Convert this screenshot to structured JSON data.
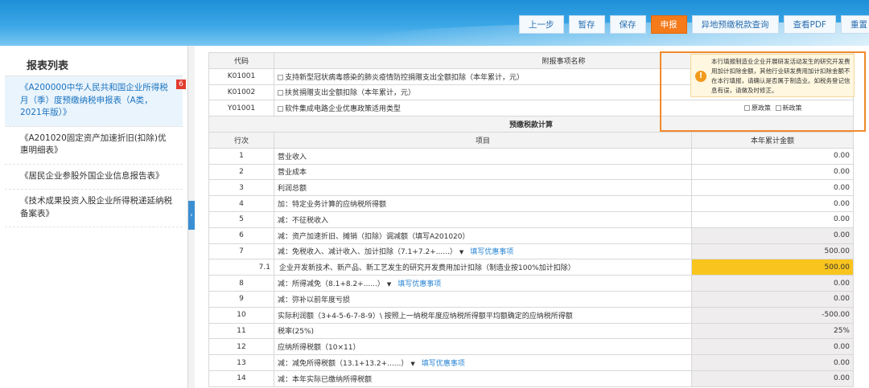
{
  "toolbar": {
    "prev": "上一步",
    "draft": "暂存",
    "save": "保存",
    "declare": "申报",
    "remote": "异地预缴税款查询",
    "pdf": "查看PDF",
    "reset": "重置"
  },
  "sidebar": {
    "title": "报表列表",
    "items": [
      {
        "label": "《A200000中华人民共和国企业所得税月（季）度预缴纳税申报表（A类，2021年版）》",
        "badge": "6"
      },
      {
        "label": "《A201020固定资产加速折旧(扣除)优惠明细表》"
      },
      {
        "label": "《居民企业参股外国企业信息报告表》"
      },
      {
        "label": "《技术成果投资入股企业所得税递延纳税备案表》"
      }
    ]
  },
  "tip": {
    "text": "本行填报制造业企业开展研发活动发生的研究开发费用加计扣除金额，其他行业研发费用加计扣除金额不在本行填报，请确认是否属于制造业。如税务登记信息有误，请做及时修正。",
    "option_old": "原政策",
    "option_new": "新政策"
  },
  "attach": {
    "col_code": "代码",
    "col_name": "附报事项名称",
    "rows": [
      {
        "code": "K01001",
        "name": "支持新型冠状病毒感染的肺炎疫情防控捐赠支出全额扣除（本年累计，元）"
      },
      {
        "code": "K01002",
        "name": "扶贫捐赠支出全额扣除（本年累计，元）"
      },
      {
        "code": "Y01001",
        "name": "软件集成电路企业优惠政策适用类型"
      }
    ]
  },
  "calc": {
    "section_title": "预缴税款计算",
    "col_row": "行次",
    "col_item": "项目",
    "col_amount": "本年累计金额",
    "link_text": "填写优惠事项",
    "rows": [
      {
        "no": "1",
        "item": "营业收入",
        "amount": "0.00"
      },
      {
        "no": "2",
        "item": "营业成本",
        "amount": "0.00"
      },
      {
        "no": "3",
        "item": "利润总额",
        "amount": "0.00"
      },
      {
        "no": "4",
        "item": "加：特定业务计算的应纳税所得额",
        "amount": "0.00"
      },
      {
        "no": "5",
        "item": "减：不征税收入",
        "amount": "0.00"
      },
      {
        "no": "6",
        "item": "减：资产加速折旧、摊销（扣除）调减额（填写A201020）",
        "amount": "0.00"
      },
      {
        "no": "7",
        "item": "减：免税收入、减计收入、加计扣除（7.1+7.2+......）",
        "amount": "500.00"
      },
      {
        "no": "7.1",
        "item": "企业开发新技术、新产品、新工艺发生的研究开发费用加计扣除（制造业按100%加计扣除）",
        "amount": "500.00"
      },
      {
        "no": "8",
        "item": "减：所得减免（8.1+8.2+......）",
        "amount": "0.00"
      },
      {
        "no": "9",
        "item": "减：弥补以前年度亏损",
        "amount": "0.00"
      },
      {
        "no": "10",
        "item": "实际利润额（3+4-5-6-7-8-9）\\ 按照上一纳税年度应纳税所得额平均额确定的应纳税所得额",
        "amount": "-500.00"
      },
      {
        "no": "11",
        "item": "税率(25%)",
        "amount": "25%"
      },
      {
        "no": "12",
        "item": "应纳所得税额（10×11）",
        "amount": "0.00"
      },
      {
        "no": "13",
        "item": "减：减免所得税额（13.1+13.2+......）",
        "amount": "0.00"
      },
      {
        "no": "14",
        "item": "减：本年实际已缴纳所得税额",
        "amount": "0.00"
      }
    ]
  }
}
